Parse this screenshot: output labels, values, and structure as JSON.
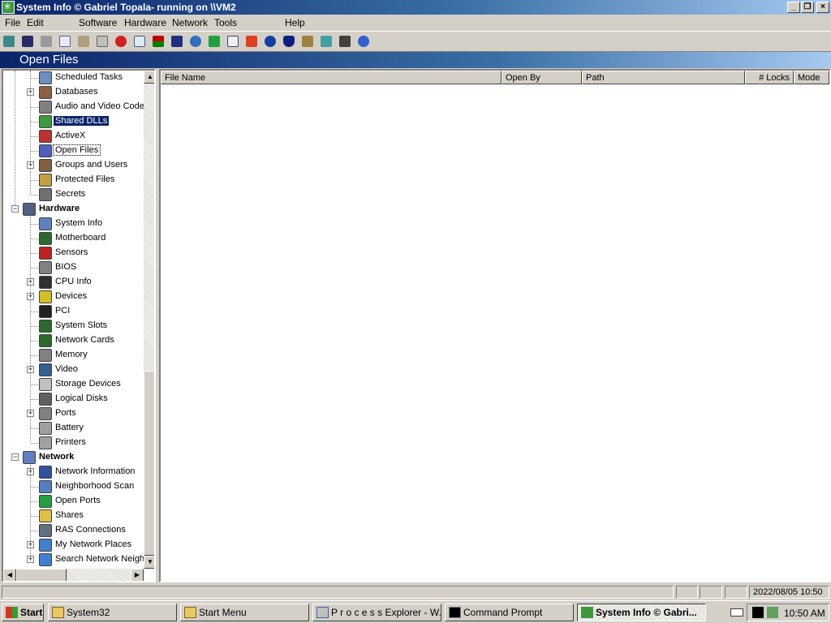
{
  "window": {
    "title": "System Info  © Gabriel Topala- running on \\\\VM2"
  },
  "menu": [
    "File",
    "Edit",
    "Software",
    "Hardware",
    "Network",
    "Tools",
    "Help"
  ],
  "section_title": "Open Files",
  "tree": [
    {
      "label": "Scheduled Tasks",
      "icon": "scheduled-tasks-icon"
    },
    {
      "label": "Databases",
      "icon": "databases-icon",
      "expandable": true
    },
    {
      "label": "Audio and Video Codecs",
      "icon": "codecs-icon"
    },
    {
      "label": "Shared DLLs",
      "icon": "dll-icon",
      "selected": true
    },
    {
      "label": "ActiveX",
      "icon": "activex-icon"
    },
    {
      "label": "Open Files",
      "icon": "open-files-icon",
      "focused": true
    },
    {
      "label": "Groups and Users",
      "icon": "users-icon",
      "expandable": true
    },
    {
      "label": "Protected Files",
      "icon": "protected-files-icon"
    },
    {
      "label": "Secrets",
      "icon": "secrets-icon"
    },
    {
      "label": "Hardware",
      "icon": "hardware-icon",
      "category": true
    },
    {
      "label": "System Info",
      "icon": "system-info-icon"
    },
    {
      "label": "Motherboard",
      "icon": "motherboard-icon"
    },
    {
      "label": "Sensors",
      "icon": "thermometer-icon"
    },
    {
      "label": "BIOS",
      "icon": "bios-chip-icon"
    },
    {
      "label": "CPU Info",
      "icon": "cpu-icon",
      "expandable": true
    },
    {
      "label": "Devices",
      "icon": "devices-icon",
      "expandable": true
    },
    {
      "label": "PCI",
      "icon": "pci-icon"
    },
    {
      "label": "System Slots",
      "icon": "slots-icon"
    },
    {
      "label": "Network Cards",
      "icon": "network-card-icon"
    },
    {
      "label": "Memory",
      "icon": "memory-icon"
    },
    {
      "label": "Video",
      "icon": "video-icon",
      "expandable": true
    },
    {
      "label": "Storage Devices",
      "icon": "storage-icon"
    },
    {
      "label": "Logical Disks",
      "icon": "disk-icon"
    },
    {
      "label": "Ports",
      "icon": "ports-icon",
      "expandable": true
    },
    {
      "label": "Battery",
      "icon": "battery-icon"
    },
    {
      "label": "Printers",
      "icon": "printer-icon"
    },
    {
      "label": "Network",
      "icon": "network-icon",
      "category": true
    },
    {
      "label": "Network Information",
      "icon": "network-info-icon",
      "expandable": true
    },
    {
      "label": "Neighborhood Scan",
      "icon": "neighborhood-icon"
    },
    {
      "label": "Open Ports",
      "icon": "open-ports-icon"
    },
    {
      "label": "Shares",
      "icon": "shares-icon"
    },
    {
      "label": "RAS Connections",
      "icon": "ras-icon"
    },
    {
      "label": "My Network Places",
      "icon": "network-places-icon",
      "expandable": true
    },
    {
      "label": "Search Network Neighborhood",
      "icon": "search-network-icon",
      "expandable": true
    }
  ],
  "columns": [
    "File Name",
    "Open By",
    "Path",
    "# Locks",
    "Mode"
  ],
  "status": {
    "datetime": "2022/08/05 10:50"
  },
  "taskbar": {
    "start": "Start",
    "tasks": [
      {
        "label": "System32",
        "icon": "folder-icon"
      },
      {
        "label": "Start Menu",
        "icon": "folder-icon"
      },
      {
        "label": "P r o c e s s  Explorer - W...",
        "icon": "process-explorer-icon"
      },
      {
        "label": "Command Prompt",
        "icon": "cmd-icon"
      },
      {
        "label": "System Info  © Gabri...",
        "icon": "system-info-app-icon",
        "active": true
      }
    ],
    "clock": "10:50 AM"
  }
}
